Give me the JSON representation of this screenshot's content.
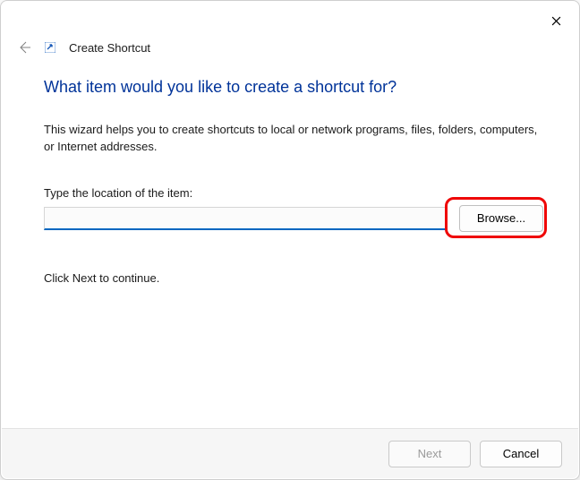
{
  "window": {
    "title": "Create Shortcut"
  },
  "heading": "What item would you like to create a shortcut for?",
  "description": "This wizard helps you to create shortcuts to local or network programs, files, folders, computers, or Internet addresses.",
  "location": {
    "label": "Type the location of the item:",
    "value": "",
    "browse_label": "Browse..."
  },
  "continue_text": "Click Next to continue.",
  "footer": {
    "next_label": "Next",
    "cancel_label": "Cancel",
    "next_enabled": false
  },
  "annotation": {
    "highlight_target": "browse-button"
  }
}
